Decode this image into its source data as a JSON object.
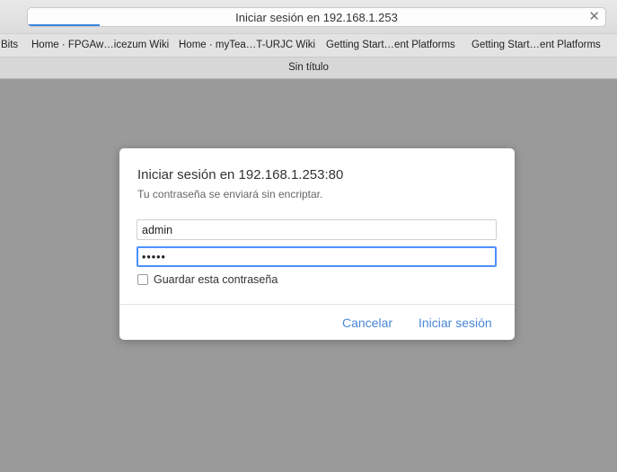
{
  "address_bar": {
    "title": "Iniciar sesión en 192.168.1.253",
    "load_progress": 0.13
  },
  "bookmarks": [
    "Bits",
    "Home · FPGAw…icezum Wiki",
    "Home · myTea…T-URJC Wiki",
    "Getting Start…ent Platforms",
    "Getting Start…ent Platforms"
  ],
  "tab": {
    "title": "Sin título"
  },
  "dialog": {
    "title": "Iniciar sesión en 192.168.1.253:80",
    "subtitle": "Tu contraseña se enviará sin encriptar.",
    "username_value": "admin",
    "password_value": "•••••",
    "remember_label": "Guardar esta contraseña",
    "remember_checked": false,
    "cancel_label": "Cancelar",
    "signin_label": "Iniciar sesión"
  },
  "colors": {
    "accent": "#4a86d8",
    "focus_ring": "#4d90fe",
    "backdrop": "#9a9a9a"
  },
  "icons": {
    "close": "close-icon"
  }
}
